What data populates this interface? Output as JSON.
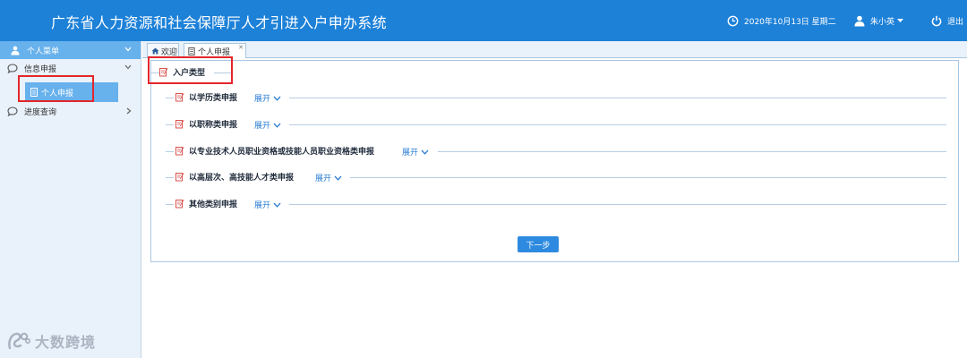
{
  "header": {
    "title": "广东省人力资源和社会保障厅人才引进入户申办系统",
    "date": "2020年10月13日 星期二",
    "user": "朱小英",
    "logout": "退出",
    "background": "#1d81d8"
  },
  "sidebar": {
    "header": "个人菜单",
    "groups": [
      {
        "label": "信息申报",
        "expanded": true
      },
      {
        "label": "进度查询",
        "expanded": false
      }
    ],
    "sub_item": "个人申报"
  },
  "tabs": [
    {
      "label": "欢迎"
    },
    {
      "label": "个人申报"
    }
  ],
  "form": {
    "section_title": "入户类型",
    "expand_label": "展开",
    "categories": [
      {
        "label": "以学历类申报"
      },
      {
        "label": "以职称类申报"
      },
      {
        "label": "以专业技术人员职业资格或技能人员职业资格类申报"
      },
      {
        "label": "以高层次、高技能人才类申报"
      },
      {
        "label": "其他类别申报"
      }
    ],
    "next_button": "下一步"
  },
  "watermark": {
    "text": "大数跨境"
  },
  "colors": {
    "accent": "#2e8ae0",
    "highlight": "#e3262b",
    "sidebar_active": "#67b1ec"
  }
}
